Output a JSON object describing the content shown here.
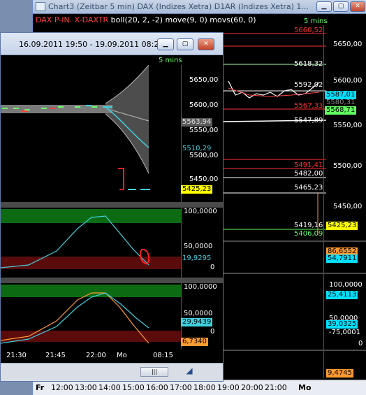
{
  "back_window": {
    "title": "Chart3 (Zeitbar 5 min)  DAX (Indizes Xetra) D1AR (Indizes Xetra) 1...",
    "subtitle_symbol": "DAX P-IN. X-DAXTR",
    "subtitle_indicators": "boll(20, 2, -2) move(9, 0) movs(60, 0)",
    "interval": "5 mins",
    "price_axis": [
      "5650,00",
      "5600,00",
      "5550,00",
      "5500,00",
      "5450,00"
    ],
    "levels": [
      {
        "value": "5660,52",
        "color": "#ff3030"
      },
      {
        "value": "5618,32",
        "color": "#ffffff"
      },
      {
        "value": "5592,02",
        "color": "#ffffff"
      },
      {
        "value": "5587,01",
        "color": "#00e0ff"
      },
      {
        "value": "5580,31",
        "color": "#888888"
      },
      {
        "value": "5568,71",
        "color": "#60ff60"
      },
      {
        "value": "5567,33",
        "color": "#ff3030"
      },
      {
        "value": "5547,89",
        "color": "#ffffff"
      },
      {
        "value": "5491,41",
        "color": "#ff3030"
      },
      {
        "value": "5482,00",
        "color": "#ffffff"
      },
      {
        "value": "5465,23",
        "color": "#ffffff"
      },
      {
        "value": "5425,23",
        "color": "#ffff00"
      },
      {
        "value": "5419,16",
        "color": "#ffffff"
      },
      {
        "value": "5406,09",
        "color": "#60ff60"
      }
    ],
    "panel2_labels": [
      "86,6552",
      "54,7911"
    ],
    "panel3_labels": [
      "100,0000",
      "25,4113",
      "50,0000",
      "39,0325",
      "-75,0001",
      "0"
    ],
    "panel4_labels": [
      "9,4745"
    ],
    "time_axis": [
      "Fr",
      "12:00",
      "13:00",
      "14:00",
      "15:00",
      "16:00",
      "17:00",
      "18:00",
      "19:00",
      "20:00",
      "21:00",
      "Mo"
    ]
  },
  "front_window": {
    "title": "16.09.2011 19:50 - 19.09.2011 08:20",
    "interval": "5 mins",
    "price_axis": [
      "5650,00",
      "5600,00",
      "5550,00",
      "5500,00",
      "5450,00"
    ],
    "price_labels": {
      "gray": "5563,94",
      "cyan": "5510,29",
      "yellow": "5425,23"
    },
    "osc1_axis": [
      "100,0000",
      "50,0000",
      "0"
    ],
    "osc1_label": "19,9295",
    "osc2_axis": [
      "100,0000",
      "50,0000",
      "0"
    ],
    "osc2_labels": {
      "cyan": "29,9439",
      "orange": "6,7340"
    },
    "time_axis": [
      "21:30",
      "21:45",
      "22:00",
      "Mo",
      "08:15"
    ]
  },
  "colors": {
    "cyan": "#40d0e0",
    "yellow": "#ffff00",
    "green_zone": "#0c6b12",
    "red_zone": "#5a0c0c",
    "orange": "#ff9a30"
  }
}
